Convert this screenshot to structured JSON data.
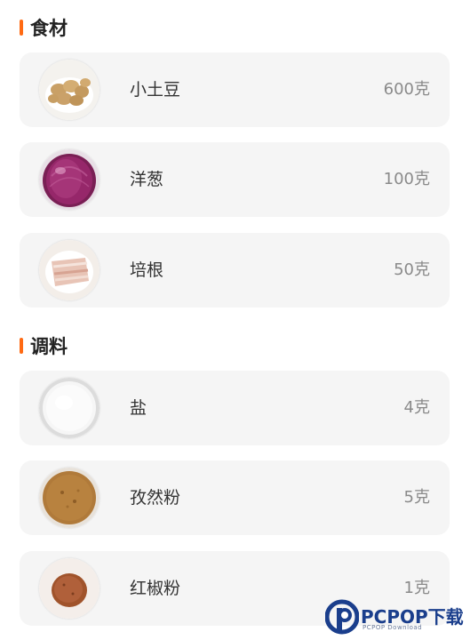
{
  "sections": {
    "ingredients": {
      "title": "食材",
      "items": [
        {
          "name": "小土豆",
          "amount": "600克",
          "icon": "potatoes-icon"
        },
        {
          "name": "洋葱",
          "amount": "100克",
          "icon": "onion-icon"
        },
        {
          "name": "培根",
          "amount": "50克",
          "icon": "bacon-icon"
        }
      ]
    },
    "seasonings": {
      "title": "调料",
      "items": [
        {
          "name": "盐",
          "amount": "4克",
          "icon": "salt-icon"
        },
        {
          "name": "孜然粉",
          "amount": "5克",
          "icon": "cumin-powder-icon"
        },
        {
          "name": "红椒粉",
          "amount": "1克",
          "icon": "paprika-powder-icon"
        }
      ]
    }
  },
  "watermark": {
    "brand": "PCPOP下载",
    "sub": "PCPOP Download"
  },
  "colors": {
    "accent": "#ff6a13",
    "card_bg": "#f5f5f5",
    "amount_text": "#8a8a8a"
  }
}
